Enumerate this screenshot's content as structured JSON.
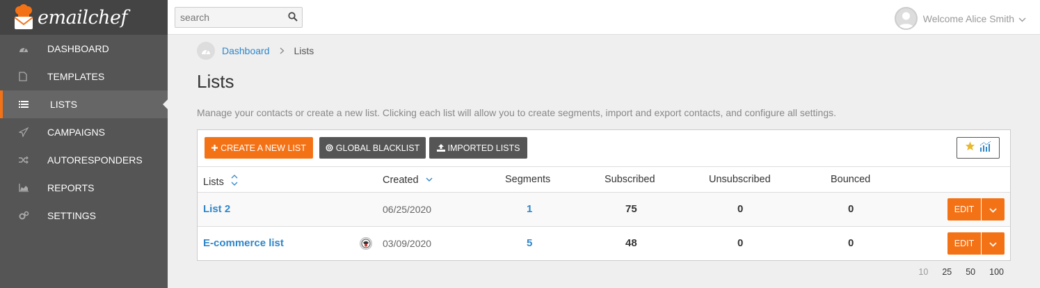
{
  "app": {
    "logo_text": "emailchef"
  },
  "search": {
    "placeholder": "search"
  },
  "user": {
    "welcome": "Welcome Alice Smith"
  },
  "sidebar": {
    "items": [
      {
        "label": "DASHBOARD",
        "icon": "gauge-icon",
        "active": false
      },
      {
        "label": "TEMPLATES",
        "icon": "file-icon",
        "active": false
      },
      {
        "label": "LISTS",
        "icon": "list-icon",
        "active": true
      },
      {
        "label": "CAMPAIGNS",
        "icon": "paper-plane-icon",
        "active": false
      },
      {
        "label": "AUTORESPONDERS",
        "icon": "shuffle-icon",
        "active": false
      },
      {
        "label": "REPORTS",
        "icon": "area-chart-icon",
        "active": false
      },
      {
        "label": "SETTINGS",
        "icon": "cogs-icon",
        "active": false
      }
    ]
  },
  "breadcrumb": {
    "root": "Dashboard",
    "current": "Lists"
  },
  "page": {
    "title": "Lists",
    "description": "Manage your contacts or create a new list. Clicking each list will allow you to create segments, import and export contacts, and configure all settings."
  },
  "toolbar": {
    "create_label": "CREATE A NEW LIST",
    "blacklist_label": "GLOBAL BLACKLIST",
    "imported_label": "IMPORTED LISTS"
  },
  "table": {
    "headers": {
      "lists": "Lists",
      "created": "Created",
      "segments": "Segments",
      "subscribed": "Subscribed",
      "unsubscribed": "Unsubscribed",
      "bounced": "Bounced"
    },
    "rows": [
      {
        "name": "List 2",
        "created": "06/25/2020",
        "segments": "1",
        "subscribed": "75",
        "unsubscribed": "0",
        "bounced": "0",
        "edit": "EDIT",
        "plugin": false
      },
      {
        "name": "E-commerce list",
        "created": "03/09/2020",
        "segments": "5",
        "subscribed": "48",
        "unsubscribed": "0",
        "bounced": "0",
        "edit": "EDIT",
        "plugin": true
      }
    ]
  },
  "pagination": {
    "options": [
      "10",
      "25",
      "50",
      "100"
    ],
    "current": "10"
  },
  "colors": {
    "accent": "#f47216",
    "link": "#2f86c9",
    "sidebar": "#555555"
  }
}
